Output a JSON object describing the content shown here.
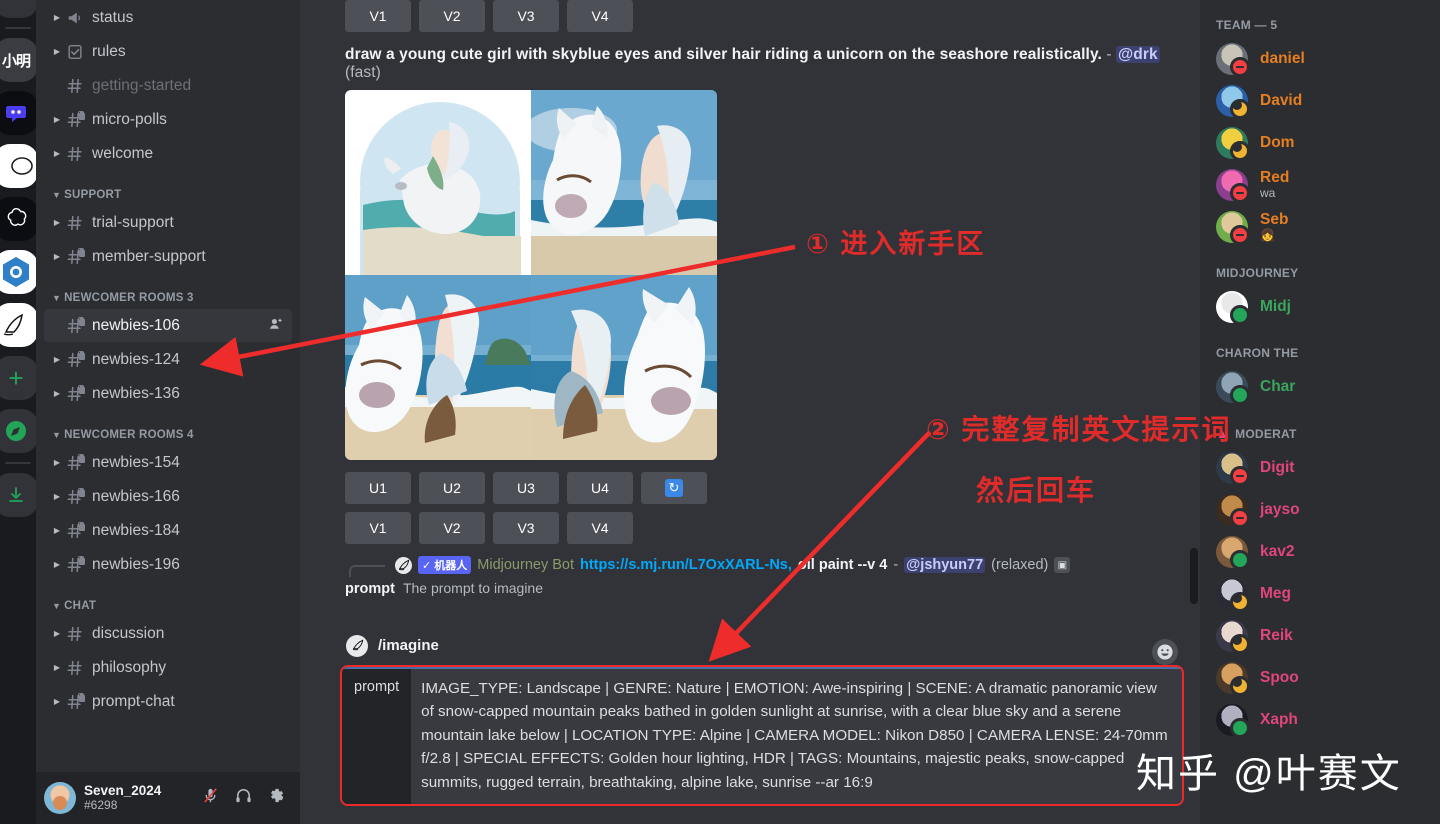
{
  "server_rail": {
    "items": [
      {
        "name": "guild-notification-badge",
        "label": ""
      },
      {
        "name": "guild-chinese",
        "label": "小明"
      },
      {
        "name": "guild-discord-dev",
        "label": ""
      },
      {
        "name": "guild-white-circle",
        "label": ""
      },
      {
        "name": "guild-openai",
        "label": ""
      },
      {
        "name": "guild-blue-token",
        "label": ""
      },
      {
        "name": "guild-midjourney",
        "label": ""
      },
      {
        "name": "add-server",
        "label": "+"
      },
      {
        "name": "explore-servers",
        "label": "➤"
      },
      {
        "name": "download-apps",
        "label": "↓"
      }
    ]
  },
  "sidebar": {
    "groups": [
      {
        "label": "",
        "channels": [
          {
            "label": "status",
            "icon": "announcement",
            "arrow": true,
            "locked": false,
            "state": "bright"
          },
          {
            "label": "rules",
            "icon": "rules",
            "arrow": true,
            "locked": false,
            "state": "bright"
          },
          {
            "label": "getting-started",
            "icon": "hash",
            "arrow": false,
            "locked": false,
            "state": "muted"
          },
          {
            "label": "micro-polls",
            "icon": "hash",
            "arrow": true,
            "locked": true,
            "state": "bright"
          },
          {
            "label": "welcome",
            "icon": "hash",
            "arrow": true,
            "locked": false,
            "state": "bright"
          }
        ]
      },
      {
        "label": "SUPPORT",
        "channels": [
          {
            "label": "trial-support",
            "icon": "hash",
            "arrow": true,
            "locked": false,
            "state": "bright"
          },
          {
            "label": "member-support",
            "icon": "hash",
            "arrow": true,
            "locked": true,
            "state": "bright"
          }
        ]
      },
      {
        "label": "NEWCOMER ROOMS 3",
        "channels": [
          {
            "label": "newbies-106",
            "icon": "hash",
            "arrow": false,
            "locked": true,
            "state": "active",
            "trailing": "add-member"
          },
          {
            "label": "newbies-124",
            "icon": "hash",
            "arrow": true,
            "locked": true,
            "state": "bright"
          },
          {
            "label": "newbies-136",
            "icon": "hash",
            "arrow": true,
            "locked": true,
            "state": "bright"
          }
        ]
      },
      {
        "label": "NEWCOMER ROOMS 4",
        "channels": [
          {
            "label": "newbies-154",
            "icon": "hash",
            "arrow": true,
            "locked": true,
            "state": "bright"
          },
          {
            "label": "newbies-166",
            "icon": "hash",
            "arrow": true,
            "locked": true,
            "state": "bright"
          },
          {
            "label": "newbies-184",
            "icon": "hash",
            "arrow": true,
            "locked": true,
            "state": "bright"
          },
          {
            "label": "newbies-196",
            "icon": "hash",
            "arrow": true,
            "locked": true,
            "state": "bright"
          }
        ]
      },
      {
        "label": "CHAT",
        "channels": [
          {
            "label": "discussion",
            "icon": "hash",
            "arrow": true,
            "locked": false,
            "state": "bright"
          },
          {
            "label": "philosophy",
            "icon": "hash",
            "arrow": true,
            "locked": false,
            "state": "bright"
          },
          {
            "label": "prompt-chat",
            "icon": "hash",
            "arrow": true,
            "locked": true,
            "state": "bright"
          }
        ]
      }
    ],
    "user": {
      "name": "Seven_2024",
      "tag": "#6298",
      "mic_icon": "mic-muted-icon",
      "headset_icon": "headphones-icon",
      "settings_icon": "gear-icon"
    }
  },
  "main": {
    "upper_button_row": {
      "buttons": [
        "V1",
        "V2",
        "V3",
        "V4"
      ]
    },
    "message": {
      "prompt_text": "draw a young cute girl with skyblue eyes and silver hair riding a unicorn on the seashore realistically.",
      "separator": "-",
      "mention": "@drk",
      "mode": "(fast)"
    },
    "u_row": {
      "buttons": [
        "U1",
        "U2",
        "U3",
        "U4"
      ],
      "reroll_icon": "reroll-icon"
    },
    "v_row": {
      "buttons": [
        "V1",
        "V2",
        "V3",
        "V4"
      ]
    },
    "bot_reply": {
      "bot_badge": "✓ 机器人",
      "bot_name": "Midjourney Bot",
      "link": "https://s.mj.run/L7OxXARL-Ns,",
      "args": "oil paint --v 4",
      "separator": "-",
      "mention": "@jshyun77",
      "mode": "(relaxed)",
      "attachment_icon": "image-icon"
    },
    "slash_hint": {
      "option": "prompt",
      "description": "The prompt to imagine"
    },
    "compose": {
      "command": "/imagine",
      "option_pill": "prompt",
      "typed_text": "IMAGE_TYPE: Landscape | GENRE: Nature | EMOTION: Awe-inspiring | SCENE: A dramatic panoramic view of snow-capped mountain peaks bathed in golden sunlight at sunrise, with a clear blue sky and a serene mountain lake below | LOCATION TYPE: Alpine | CAMERA MODEL: Nikon D850 | CAMERA LENSE: 24-70mm f/2.8 | SPECIAL EFFECTS: Golden hour lighting, HDR | TAGS: Mountains, majestic peaks, snow-capped summits, rugged terrain, breathtaking, alpine lake, sunrise --ar 16:9",
      "emoji_icon": "emoji-icon"
    }
  },
  "members": {
    "groups": [
      {
        "label": "TEAM — 5",
        "icon": "",
        "color": "#e67e22",
        "people": [
          {
            "name": "daniel",
            "status": "dnd",
            "sub": ""
          },
          {
            "name": "David",
            "status": "idle",
            "sub": ""
          },
          {
            "name": "Dom",
            "status": "idle",
            "sub": ""
          },
          {
            "name": "Red",
            "status": "dnd",
            "sub": "wa"
          },
          {
            "name": "Seb",
            "status": "dnd",
            "sub": "👧"
          }
        ]
      },
      {
        "label": "MIDJOURNEY",
        "icon": "",
        "color": "#3ba55d",
        "people": [
          {
            "name": "Midj",
            "status": "online",
            "sub": ""
          }
        ]
      },
      {
        "label": "CHARON THE",
        "icon": "",
        "color": "#3ba55d",
        "people": [
          {
            "name": "Char",
            "status": "online",
            "sub": ""
          }
        ]
      },
      {
        "label": "MODERAT",
        "icon": "boat",
        "color": "#e0457b",
        "people": [
          {
            "name": "Digit",
            "status": "dnd",
            "sub": ""
          },
          {
            "name": "jayso",
            "status": "dnd",
            "sub": ""
          },
          {
            "name": "kav2",
            "status": "online",
            "sub": ""
          },
          {
            "name": "Meg",
            "status": "idle",
            "sub": ""
          },
          {
            "name": "Reik",
            "status": "idle",
            "sub": ""
          },
          {
            "name": "Spoo",
            "status": "idle",
            "sub": ""
          },
          {
            "name": "Xaph",
            "status": "online",
            "sub": ""
          }
        ]
      }
    ]
  },
  "annotations": {
    "step1": "① 进入新手区",
    "step2": "② 完整复制英文提示词",
    "step3": "然后回车",
    "accent_color": "#e02b2b"
  },
  "watermark": "知乎 @叶赛文"
}
